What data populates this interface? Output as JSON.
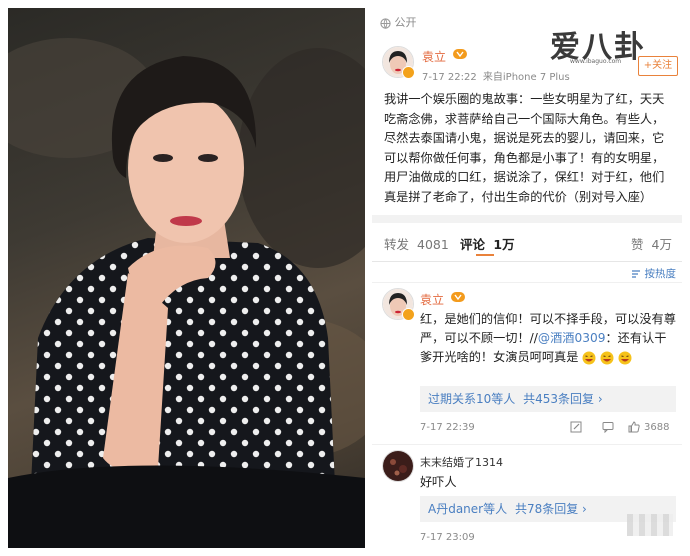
{
  "visibility": "公开",
  "watermark": {
    "logo": "爱八卦",
    "url": "www.ibaguo.com"
  },
  "post": {
    "author": "袁立",
    "time": "7-17 22:22",
    "source": "来自iPhone 7 Plus",
    "follow_label": "+关注",
    "text": "我讲一个娱乐圈的鬼故事：一些女明星为了红，天天吃斋念佛，求菩萨给自己一个国际大角色。有些人，尽然去泰国请小鬼，据说是死去的婴儿，请回来，它可以帮你做任何事，角色都是小事了！有的女明星，用尸油做成的口红，据说涂了，保红！对于红，他们真是拼了老命了，付出生命的代价（别对号入座）"
  },
  "tabs": {
    "repost_label": "转发",
    "repost_count": "4081",
    "comment_label": "评论",
    "comment_count": "1万",
    "like_label": "赞",
    "like_count": "4万"
  },
  "sort_label": "按热度",
  "comments": [
    {
      "author": "袁立",
      "text_main": "红，是她们的信仰！可以不择手段，可以没有尊严，可以不顾一切！//",
      "mention": "@酒酒0309",
      "text_tail": "：还有认干爹开光啥的！女演员呵呵真是",
      "reply_users": "过期关系10等人",
      "reply_link": "共453条回复 ›",
      "time": "7-17 22:39",
      "likes": "3688"
    },
    {
      "author": "末末结婚了1314",
      "text": "好吓人",
      "reply_users": "A丹daner等人",
      "reply_link": "共78条回复 ›",
      "time": "7-17 23:09"
    }
  ],
  "colors": {
    "accent": "#e36a3f",
    "link": "#4a7fc1",
    "badge": "#f3a21b"
  }
}
